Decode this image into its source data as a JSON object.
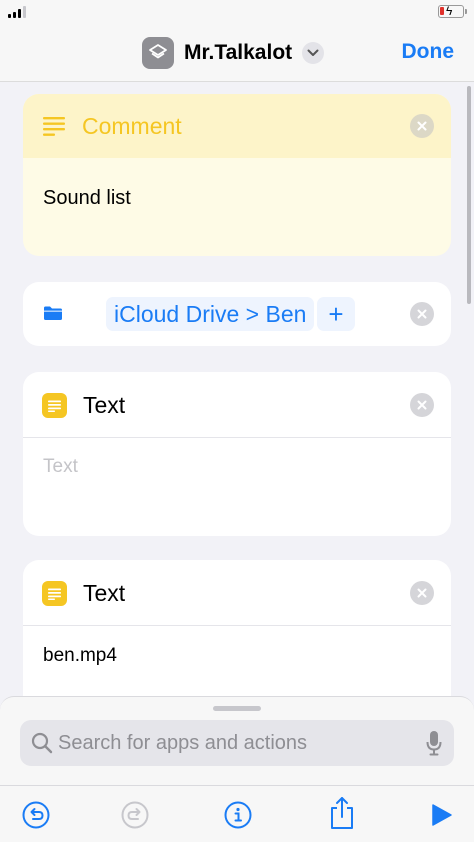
{
  "nav": {
    "title": "Mr.Talkalot",
    "done_label": "Done",
    "app_icon": "layers-icon"
  },
  "actions": {
    "comment": {
      "title": "Comment",
      "body": "Sound list"
    },
    "folder": {
      "path": "iCloud Drive > Ben",
      "add_label": "+"
    },
    "text_1": {
      "title": "Text",
      "placeholder": "Text"
    },
    "text_2": {
      "title": "Text",
      "value": "ben.mp4"
    }
  },
  "search": {
    "placeholder": "Search for apps and actions"
  },
  "toolbar": {
    "items": [
      "undo-icon",
      "redo-icon",
      "info-icon",
      "share-icon",
      "play-icon"
    ]
  },
  "colors": {
    "accent": "#1a7cf5",
    "comment_yellow": "#f5c623",
    "text_icon": "#f5c623"
  }
}
